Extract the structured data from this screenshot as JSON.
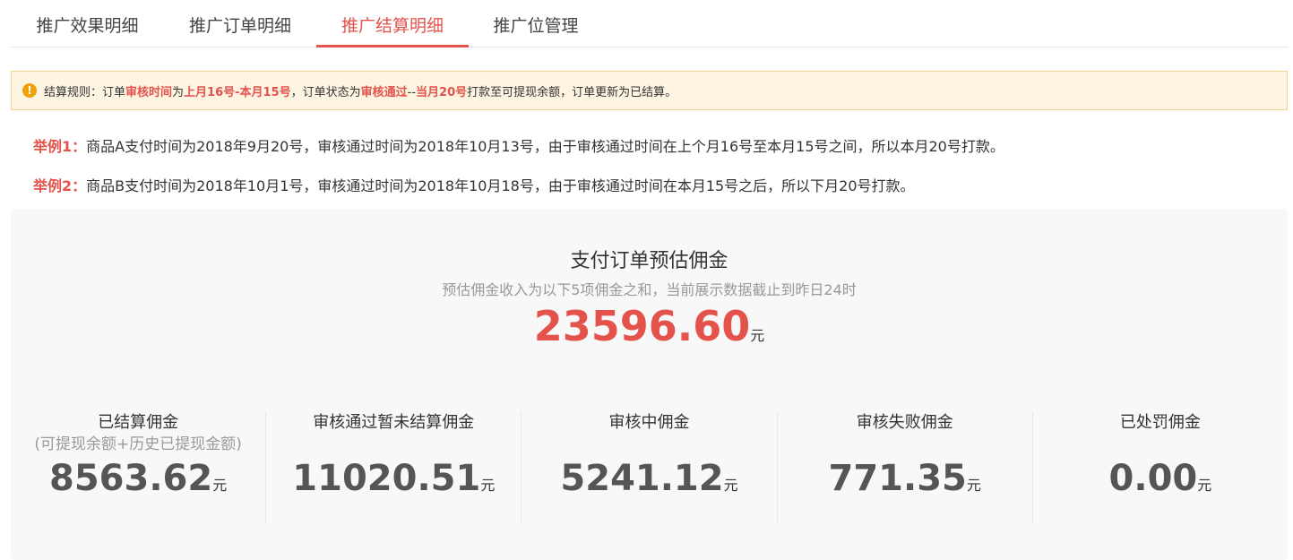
{
  "tabs": [
    {
      "label": "推广效果明细",
      "active": false
    },
    {
      "label": "推广订单明细",
      "active": false
    },
    {
      "label": "推广结算明细",
      "active": true
    },
    {
      "label": "推广位管理",
      "active": false
    }
  ],
  "notice": {
    "icon": "exclamation-icon",
    "prefix": "结算规则：订单",
    "hl1": "审核时间",
    "t2": "为",
    "hl2": "上月16号-本月15号",
    "t3": "，订单状态为",
    "hl3": "审核通过",
    "t4": "--",
    "hl4": "当月20号",
    "t5": "打款至可提现余额，订单更新为已结算。"
  },
  "examples": [
    {
      "label": "举例1：",
      "text": "商品A支付时间为2018年9月20号，审核通过时间为2018年10月13号，由于审核通过时间在上个月16号至本月15号之间，所以本月20号打款。"
    },
    {
      "label": "举例2：",
      "text": "商品B支付时间为2018年10月1号，审核通过时间为2018年10月18号，由于审核通过时间在本月15号之后，所以下月20号打款。"
    }
  ],
  "summary": {
    "title": "支付订单预估佣金",
    "subtitle": "预估佣金收入为以下5项佣金之和，当前展示数据截止到昨日24时",
    "total": "23596.60",
    "unit": "元",
    "items": [
      {
        "title": "已结算佣金",
        "note": "(可提现余额+历史已提现金额)",
        "value": "8563.62",
        "unit": "元"
      },
      {
        "title": "审核通过暂未结算佣金",
        "note": "",
        "value": "11020.51",
        "unit": "元"
      },
      {
        "title": "审核中佣金",
        "note": "",
        "value": "5241.12",
        "unit": "元"
      },
      {
        "title": "审核失败佣金",
        "note": "",
        "value": "771.35",
        "unit": "元"
      },
      {
        "title": "已处罚佣金",
        "note": "",
        "value": "0.00",
        "unit": "元"
      }
    ]
  },
  "colors": {
    "accent": "#e4524c",
    "warning": "#f0a00c",
    "notice_bg": "#fdf5e2"
  }
}
